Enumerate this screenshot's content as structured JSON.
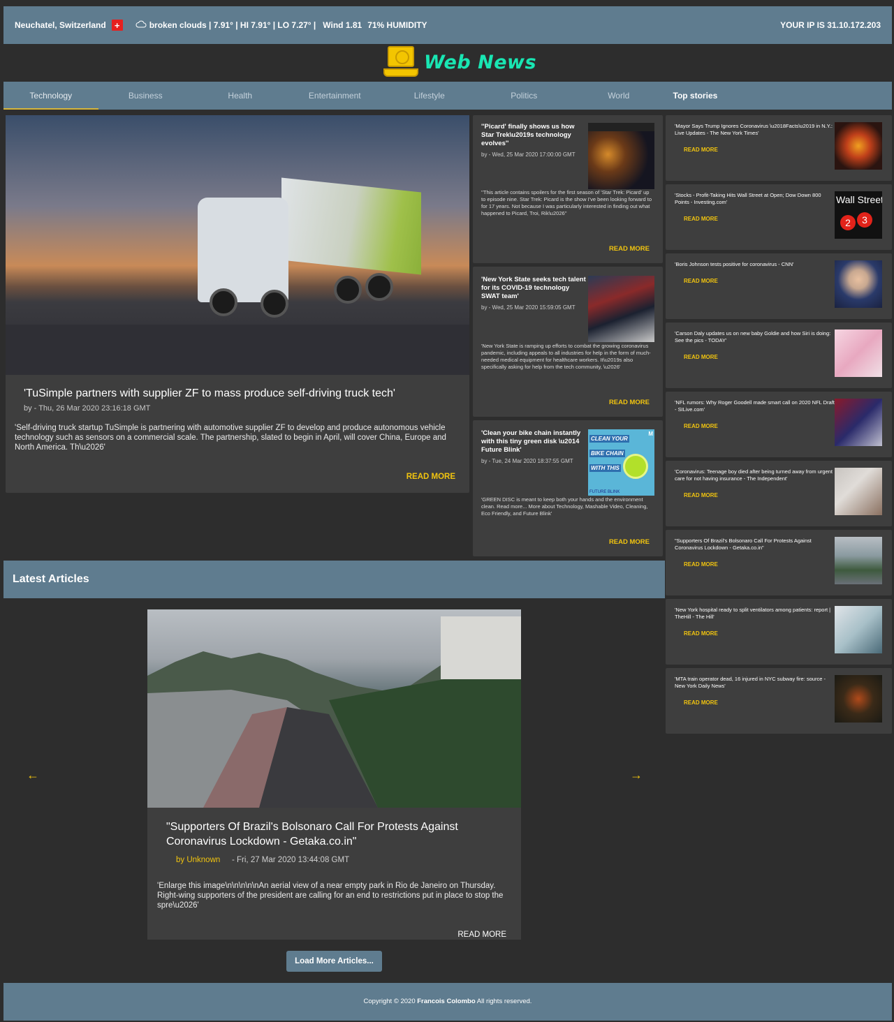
{
  "topbar": {
    "location": "Neuchatel, Switzerland",
    "weather": "broken clouds | 7.91° | HI 7.91° | LO 7.27° |",
    "wind": "Wind 1.81",
    "humidity": "71% HUMIDITY",
    "ip": "YOUR IP IS 31.10.172.203"
  },
  "logo": {
    "text": "Web News"
  },
  "nav": {
    "tabs": [
      "Technology",
      "Business",
      "Health",
      "Entertainment",
      "Lifestyle",
      "Politics",
      "World",
      "Top stories"
    ],
    "active": "Technology"
  },
  "hero": {
    "title": "'TuSimple partners with supplier ZF to mass produce self-driving truck tech'",
    "meta": "by - Thu, 26 Mar 2020 23:16:18 GMT",
    "description": "'Self-driving truck startup TuSimple is partnering with automotive supplier ZF to develop and produce autonomous vehicle technology such as sensors on a commercial scale. The partnership, slated to begin in April, will cover China, Europe and North America. Th\\u2026'",
    "read_more": "READ MORE"
  },
  "mid_articles": [
    {
      "title": "''Picard' finally shows us how Star Trek\\u2019s technology evolves''",
      "meta": "by - Wed, 25 Mar 2020 17:00:00 GMT",
      "description": "''This article contains spoilers for the first season of 'Star Trek: Picard' up to episode nine. Star Trek: Picard is the show I've been looking forward to for 17 years. Not because I was particularly interested in finding out what happened to Picard, Troi, Rik\\u2026''",
      "read_more": "READ MORE"
    },
    {
      "title": "'New York State seeks tech talent for its COVID-19 technology SWAT team'",
      "meta": "by - Wed, 25 Mar 2020 15:59:05 GMT",
      "description": "'New York State is ramping up efforts to combat the growing coronavirus pandemic, including appeals to all industries for help in the form of much-needed medical equipment for healthcare workers. It\\u2019s also specifically asking for help from the tech community, \\u2026'",
      "read_more": "READ MORE"
    },
    {
      "title": "'Clean your bike chain instantly with this tiny green disk \\u2014 Future Blink'",
      "meta": "by - Tue, 24 Mar 2020 18:37:55 GMT",
      "description": "'GREEN DISC is meant to keep both your hands and the environment clean. Read more... More about Technology, Mashable Video, Cleaning, Eco Friendly, and Future Blink'",
      "read_more": "READ MORE",
      "thumb_text": [
        "CLEAN YOUR",
        "BIKE CHAIN",
        "WITH THIS"
      ],
      "thumb_badge": "M",
      "thumb_footer": "FUTURE BLINK"
    }
  ],
  "top_stories": [
    {
      "title": "'Mayor Says Trump Ignores Coronavirus \\u2018Facts\\u2019 in N.Y.: Live Updates - The New York Times'",
      "read_more": "READ MORE"
    },
    {
      "title": "'Stocks - Profit-Taking Hits Wall Street at Open; Dow Down 800 Points - Investing.com'",
      "read_more": "READ MORE",
      "thumb_text": "Wall Street",
      "thumb_nums": [
        "2",
        "3"
      ]
    },
    {
      "title": "'Boris Johnson tests positive for coronavirus - CNN'",
      "read_more": "READ MORE"
    },
    {
      "title": "'Carson Daly updates us on new baby Goldie and how Siri is doing: See the pics - TODAY'",
      "read_more": "READ MORE"
    },
    {
      "title": "'NFL rumors: Why Roger Goodell made smart call on 2020 NFL Draft - SILive.com'",
      "read_more": "READ MORE"
    },
    {
      "title": "'Coronavirus: Teenage boy died after being turned away from urgent care for not having insurance - The Independent'",
      "read_more": "READ MORE"
    },
    {
      "title": "\"Supporters Of Brazil's Bolsonaro Call For Protests Against Coronavirus Lockdown - Getaka.co.in\"",
      "read_more": "READ MORE"
    },
    {
      "title": "'New York hospital ready to split ventilators among patients: report | TheHill - The Hill'",
      "read_more": "READ MORE"
    },
    {
      "title": "'MTA train operator dead, 16 injured in NYC subway fire: source - New York Daily News'",
      "read_more": "READ MORE"
    }
  ],
  "latest": {
    "heading": "Latest Articles",
    "prev_icon": "←",
    "next_icon": "→",
    "article": {
      "title": "\"Supporters Of Brazil's Bolsonaro Call For Protests Against Coronavirus Lockdown - Getaka.co.in\"",
      "author": "by Unknown",
      "date": "- Fri, 27 Mar 2020 13:44:08 GMT",
      "description": "'Enlarge this image\\n\\n\\n\\n\\nAn aerial view of a near empty park in Rio de Janeiro on Thursday. Right-wing supporters of the president are calling for an end to restrictions put in place to stop the spre\\u2026'",
      "read_more": "READ MORE"
    },
    "load_more": "Load More Articles..."
  },
  "footer": {
    "prefix": "Copyright © 2020 ",
    "name": "Francois Colombo",
    "suffix": " All rights reserved."
  },
  "colors": {
    "background": "#2d2d2d",
    "bar": "#5f7c8f",
    "card": "#3e3e3e",
    "accent": "#f1c40f",
    "brand": "#19e6b3"
  }
}
